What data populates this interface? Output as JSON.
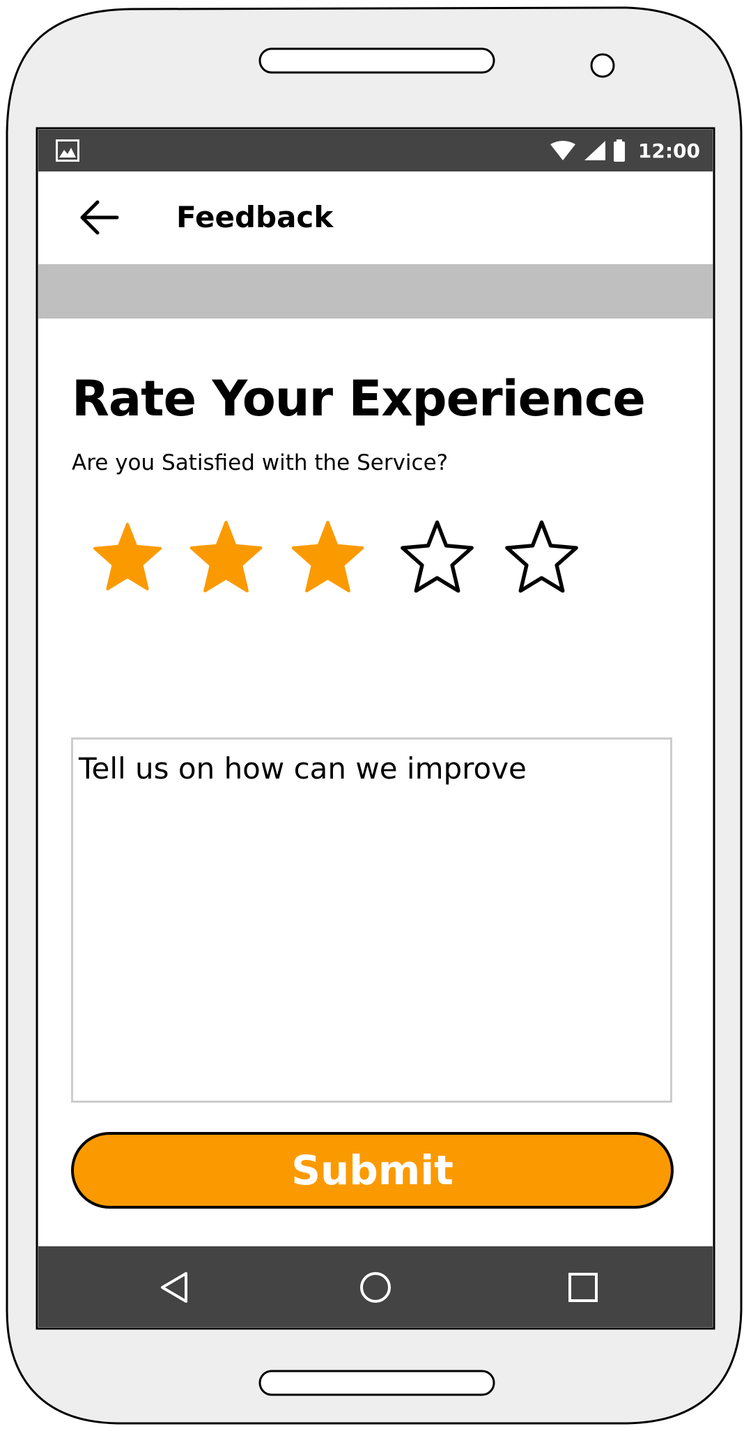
{
  "status_bar": {
    "time": "12:00",
    "left_icon": "image-notification-icon",
    "right_icons": [
      "wifi-icon",
      "cellular-signal-icon",
      "battery-icon"
    ]
  },
  "app_bar": {
    "title": "Feedback",
    "back_icon": "arrow-left-icon"
  },
  "content": {
    "heading": "Rate Your Experience",
    "subheading": "Are you Satisfied with the Service?",
    "rating": {
      "value": 3,
      "max": 5
    },
    "feedback_placeholder": "Tell us on how can we improve",
    "submit_label": "Submit"
  },
  "nav_bar": {
    "icons": [
      "nav-back-icon",
      "nav-home-icon",
      "nav-recents-icon"
    ]
  },
  "colors": {
    "accent": "#fb9a00",
    "bar_dark": "#444444",
    "band_gray": "#bfbfbf",
    "phone_body": "#eeeeee"
  }
}
